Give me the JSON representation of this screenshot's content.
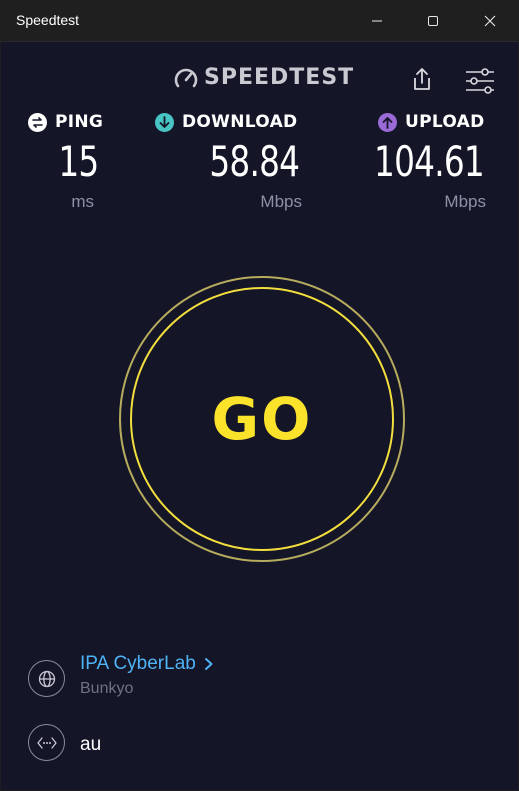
{
  "window": {
    "title": "Speedtest"
  },
  "header": {
    "logo_text": "SPEEDTEST"
  },
  "metrics": {
    "ping": {
      "label": "PING",
      "value": "15",
      "unit": "ms"
    },
    "download": {
      "label": "DOWNLOAD",
      "value": "58.84",
      "unit": "Mbps"
    },
    "upload": {
      "label": "UPLOAD",
      "value": "104.61",
      "unit": "Mbps"
    }
  },
  "go_button": {
    "label": "GO"
  },
  "server": {
    "name": "IPA CyberLab",
    "location": "Bunkyo"
  },
  "isp": {
    "name": "au"
  },
  "colors": {
    "background": "#141526",
    "go_yellow": "#fbe32c",
    "download_icon": "#48c4c4",
    "upload_icon": "#9a6ad6",
    "link_blue": "#4fb3f5"
  },
  "icons": {
    "minimize": "minimize-icon",
    "maximize": "maximize-icon",
    "close": "close-icon",
    "share": "share-icon",
    "settings": "sliders-icon",
    "ping": "ping-icon",
    "download": "download-arrow-icon",
    "upload": "upload-arrow-icon",
    "server": "globe-icon",
    "isp": "network-icon"
  }
}
